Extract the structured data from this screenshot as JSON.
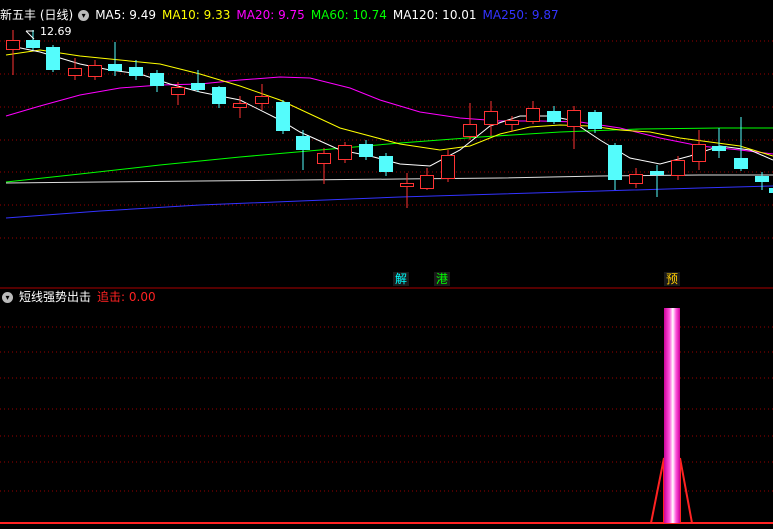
{
  "main_panel": {
    "stock_title": "新五丰 (日线)",
    "ma_legend": [
      {
        "label": "MA5: 9.49",
        "color": "#ffffff"
      },
      {
        "label": "MA10: 9.33",
        "color": "#ffff00"
      },
      {
        "label": "MA20: 9.75",
        "color": "#ff00ff"
      },
      {
        "label": "MA60: 10.74",
        "color": "#00ff00"
      },
      {
        "label": "MA120: 10.01",
        "color": "#ffffff"
      },
      {
        "label": "MA250: 9.87",
        "color": "#3333ff"
      }
    ],
    "high_marker": "12.69",
    "signals": [
      {
        "text": "解",
        "color": "#00ffff"
      },
      {
        "text": "港",
        "color": "#00ff00"
      },
      {
        "text": "预",
        "color": "#ffcc00"
      }
    ]
  },
  "indicator_panel": {
    "title": "短线强势出击",
    "value_label": "追击: 0.00",
    "title_color": "#ffffff",
    "value_color": "#ff2222"
  },
  "colors": {
    "background": "#000000",
    "grid": "#990000",
    "up_candle": "#ff3333",
    "down_candle": "#54fcfc",
    "ma5": "#ffffff",
    "ma10": "#ffff00",
    "ma20": "#ff00ff",
    "ma60": "#00ff00",
    "ma120": "#dddddd",
    "ma250": "#3333ff",
    "spike": "#ff44cc"
  }
}
